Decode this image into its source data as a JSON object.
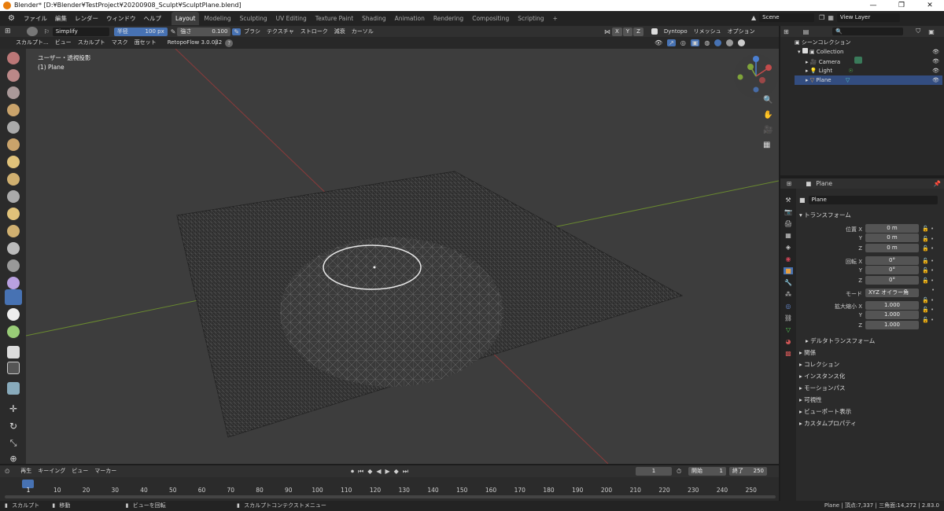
{
  "title": "Blender* [D:¥Blender¥TestProject¥20200908_Sculpt¥SculptPlane.blend]",
  "window_controls": [
    "—",
    "❐",
    "✕"
  ],
  "menus": [
    "ファイル",
    "編集",
    "レンダー",
    "ウィンドウ",
    "ヘルプ"
  ],
  "workspaces": [
    "Layout",
    "Modeling",
    "Sculpting",
    "UV Editing",
    "Texture Paint",
    "Shading",
    "Animation",
    "Rendering",
    "Compositing",
    "Scripting",
    "+"
  ],
  "active_workspace": "Layout",
  "scene": "Scene",
  "view_layer": "View Layer",
  "tool_header": {
    "brush_name": "Simplify",
    "radius_label": "半径",
    "radius_value": "100 px",
    "strength_label": "強さ",
    "strength_value": "0.100",
    "brush": "ブラシ",
    "texture": "テクスチャ",
    "stroke": "ストローク",
    "falloff": "減衰",
    "cursor": "カーソル",
    "axes": [
      "X",
      "Y",
      "Z"
    ],
    "dyntopo": "Dyntopo",
    "remesh": "リメッシュ",
    "options": "オプション"
  },
  "header2": {
    "mode": "スカルプト...",
    "view": "ビュー",
    "sculpt": "スカルプト",
    "mask": "マスク",
    "face_sets": "面セット",
    "addon": "RetopoFlow 3.0.0β2",
    "help": "?"
  },
  "viewport": {
    "view_name": "ユーザー・透視投影",
    "object": "(1) Plane",
    "gizmo": {
      "x": "X",
      "y": "Y",
      "z": "Z"
    }
  },
  "outliner": {
    "root": "シーンコレクション",
    "collection": "Collection",
    "items": [
      {
        "name": "Camera",
        "color": "#e8a040"
      },
      {
        "name": "Light",
        "color": "#e8a040"
      },
      {
        "name": "Plane",
        "color": "#e8a040",
        "selected": true
      }
    ]
  },
  "properties": {
    "header": "Plane",
    "object_name": "Plane",
    "transform": "トランスフォーム",
    "location_label": "位置",
    "rotation_label": "回転",
    "mode_label": "モード",
    "scale_label": "拡大縮小",
    "axes": [
      "X",
      "Y",
      "Z"
    ],
    "location": [
      "0 m",
      "0 m",
      "0 m"
    ],
    "rotation": [
      "0°",
      "0°",
      "0°"
    ],
    "mode": "XYZ オイラー角",
    "scale": [
      "1.000",
      "1.000",
      "1.000"
    ],
    "sub_panels": [
      "デルタトランスフォーム"
    ],
    "panels": [
      "関係",
      "コレクション",
      "インスタンス化",
      "モーションパス",
      "可視性",
      "ビューポート表示",
      "カスタムプロパティ"
    ]
  },
  "timeline": {
    "menus": [
      "再生",
      "キーイング",
      "ビュー",
      "マーカー"
    ],
    "current_frame": "1",
    "start_label": "開始",
    "start": "1",
    "end_label": "終了",
    "end": "250",
    "ticks": [
      "1",
      "10",
      "20",
      "30",
      "40",
      "50",
      "60",
      "70",
      "80",
      "90",
      "100",
      "110",
      "120",
      "130",
      "140",
      "150",
      "160",
      "170",
      "180",
      "190",
      "200",
      "210",
      "220",
      "230",
      "240",
      "250"
    ]
  },
  "status": {
    "left1": "スカルプト",
    "left2": "移動",
    "mid": "ビューを回転",
    "mid2": "スカルプトコンテクストメニュー",
    "right": "Plane | 頂点:7,337 | 三角面:14,272 | 2.83.0"
  },
  "colors": {
    "accent": "#4772b3",
    "x_axis": "#c34b4b",
    "y_axis": "#7fa33a",
    "z_axis": "#4b7fd1"
  }
}
